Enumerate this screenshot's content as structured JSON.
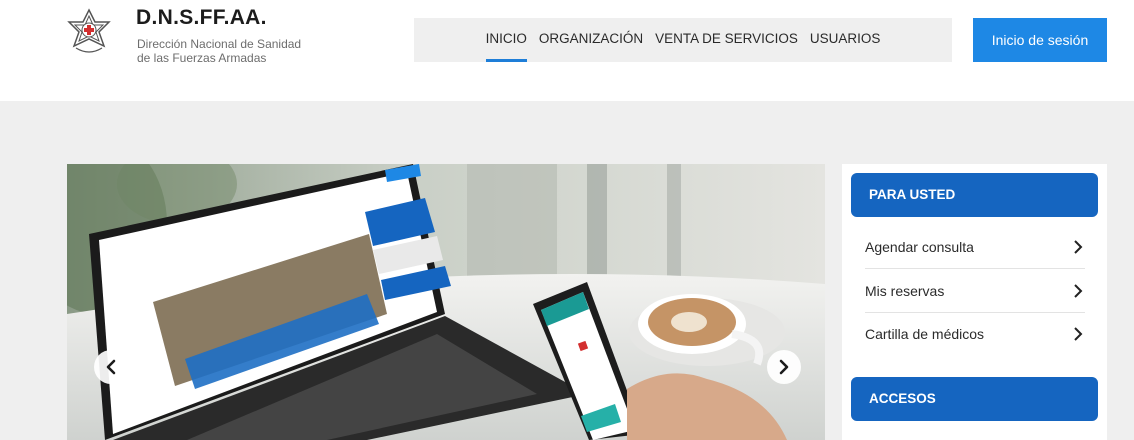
{
  "brand": {
    "title": "D.N.S.FF.AA.",
    "subtitle_line1": "Dirección Nacional de Sanidad",
    "subtitle_line2": "de las Fuerzas Armadas"
  },
  "nav": {
    "items": [
      {
        "label": "INICIO",
        "active": true
      },
      {
        "label": "ORGANIZACIÓN",
        "active": false
      },
      {
        "label": "VENTA DE SERVICIOS",
        "active": false
      },
      {
        "label": "USUARIOS",
        "active": false
      }
    ]
  },
  "login_label": "Inicio de sesión",
  "sidebar": {
    "para_usted": "PARA USTED",
    "items": [
      {
        "label": "Agendar consulta"
      },
      {
        "label": "Mis reservas"
      },
      {
        "label": "Cartilla de médicos"
      }
    ],
    "accesos": "ACCESOS"
  },
  "colors": {
    "accent": "#1e88e5",
    "sidebar_header": "#1565c0",
    "section_bg": "#efefef"
  },
  "icons": {
    "logo": "star-cross-logo-icon",
    "prev": "chevron-left-icon",
    "next": "chevron-right-icon",
    "item": "chevron-right-icon"
  }
}
